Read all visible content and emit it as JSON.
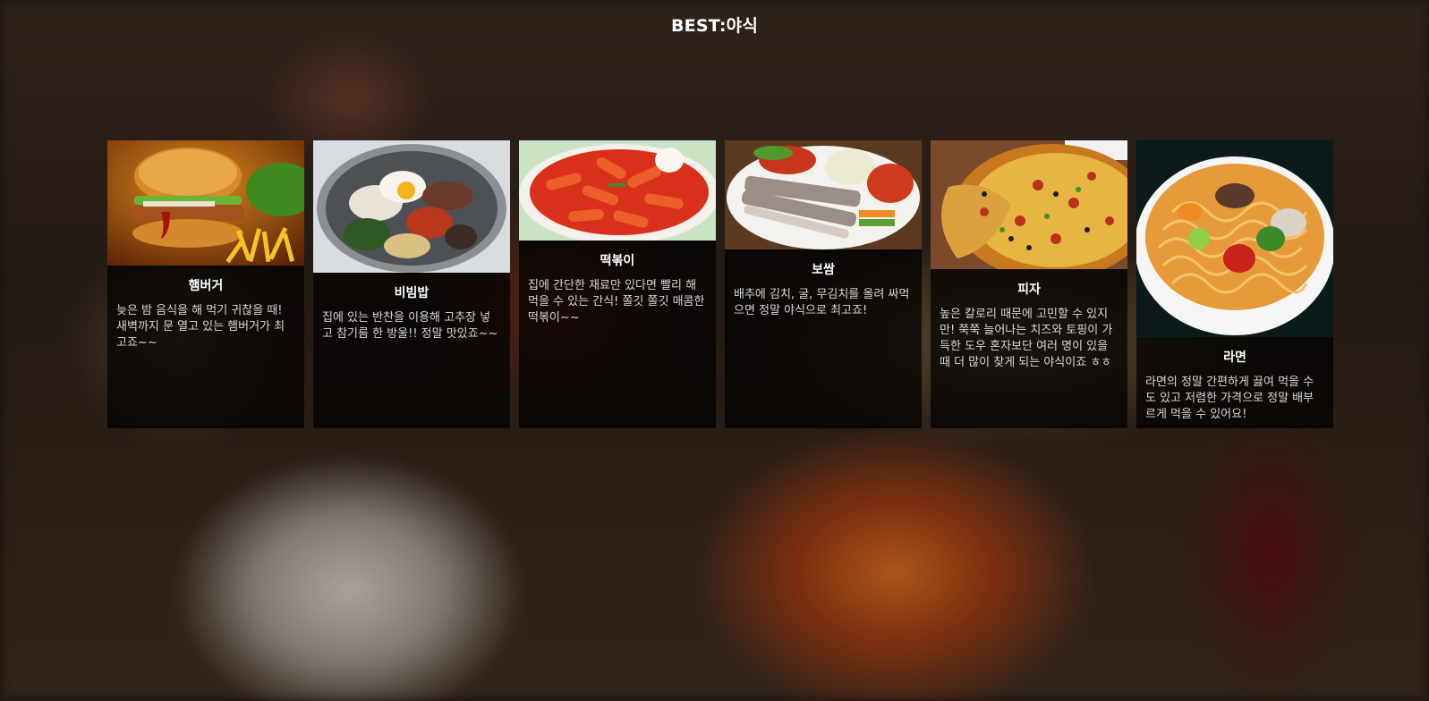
{
  "page": {
    "title": "BEST:야식"
  },
  "cards": [
    {
      "image": "hamburger-photo",
      "name": "햄버거",
      "description": "늦은 밤 음식을 해 먹기 귀찮을 때! 새벽까지 문 열고 있는 햄버거가 최고죠~~"
    },
    {
      "image": "bibimbap-photo",
      "name": "비빔밥",
      "description": "집에 있는 반찬을 이용해 고추장 넣고 참기름 한 방울!! 정말 맛있죠~~"
    },
    {
      "image": "tteokbokki-photo",
      "name": "떡볶이",
      "description": "집에 간단한 재료만 있다면 빨리 해 먹을 수 있는 간식! 쫄깃 쫄깃 매콤한 떡볶이~~"
    },
    {
      "image": "bossam-photo",
      "name": "보쌈",
      "description": "배추에 김치, 굴, 무김치를 올려 싸먹으면 정말 야식으로 최고죠!"
    },
    {
      "image": "pizza-photo",
      "name": "피자",
      "description": "높은 칼로리 때문에 고민할 수 있지만! 쭉쭉 늘어나는 치즈와 토핑이 가득한 도우 혼자보단 여러 명이 있을 때 더 많이 찾게 되는 야식이죠 ㅎㅎ"
    },
    {
      "image": "ramen-photo",
      "name": "라면",
      "description": "라면의 정말 간편하게 끓여 먹을 수도 있고 저렴한 가격으로 정말 배부르게 먹을 수 있어요!"
    }
  ]
}
